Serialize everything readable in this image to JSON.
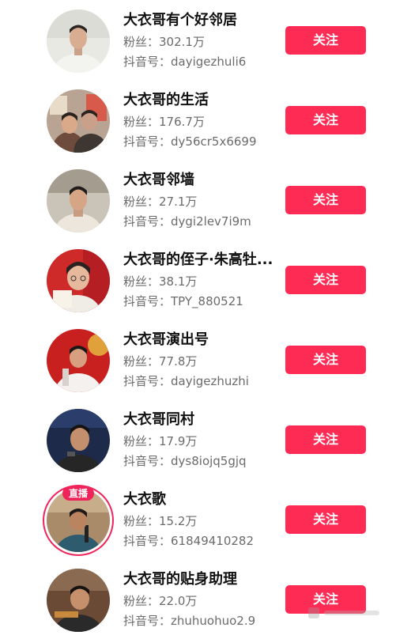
{
  "follow_label": "关注",
  "fans_label": "粉丝：",
  "dyid_label": "抖音号：",
  "live_badge": "直播",
  "accent_color": "#fe2c55",
  "users": [
    {
      "name": "大衣哥有个好邻居",
      "fans": "302.1万",
      "dyid": "dayigezhuli6"
    },
    {
      "name": "大衣哥的生活",
      "fans": "176.7万",
      "dyid": "dy56cr5x6699"
    },
    {
      "name": "大衣哥邻墙",
      "fans": "27.1万",
      "dyid": "dygi2lev7i9m"
    },
    {
      "name": "大衣哥的侄子·朱高牡...",
      "fans": "38.1万",
      "dyid": "TPY_880521"
    },
    {
      "name": "大衣哥演出号",
      "fans": "77.8万",
      "dyid": "dayigezhuzhi"
    },
    {
      "name": "大衣哥同村",
      "fans": "17.9万",
      "dyid": "dys8iojq5gjq"
    },
    {
      "name": "大衣歌",
      "fans": "15.2万",
      "dyid": "61849410282",
      "live": true
    },
    {
      "name": "大衣哥的贴身助理",
      "fans": "22.0万",
      "dyid": "zhuhuohuo2.9"
    }
  ]
}
